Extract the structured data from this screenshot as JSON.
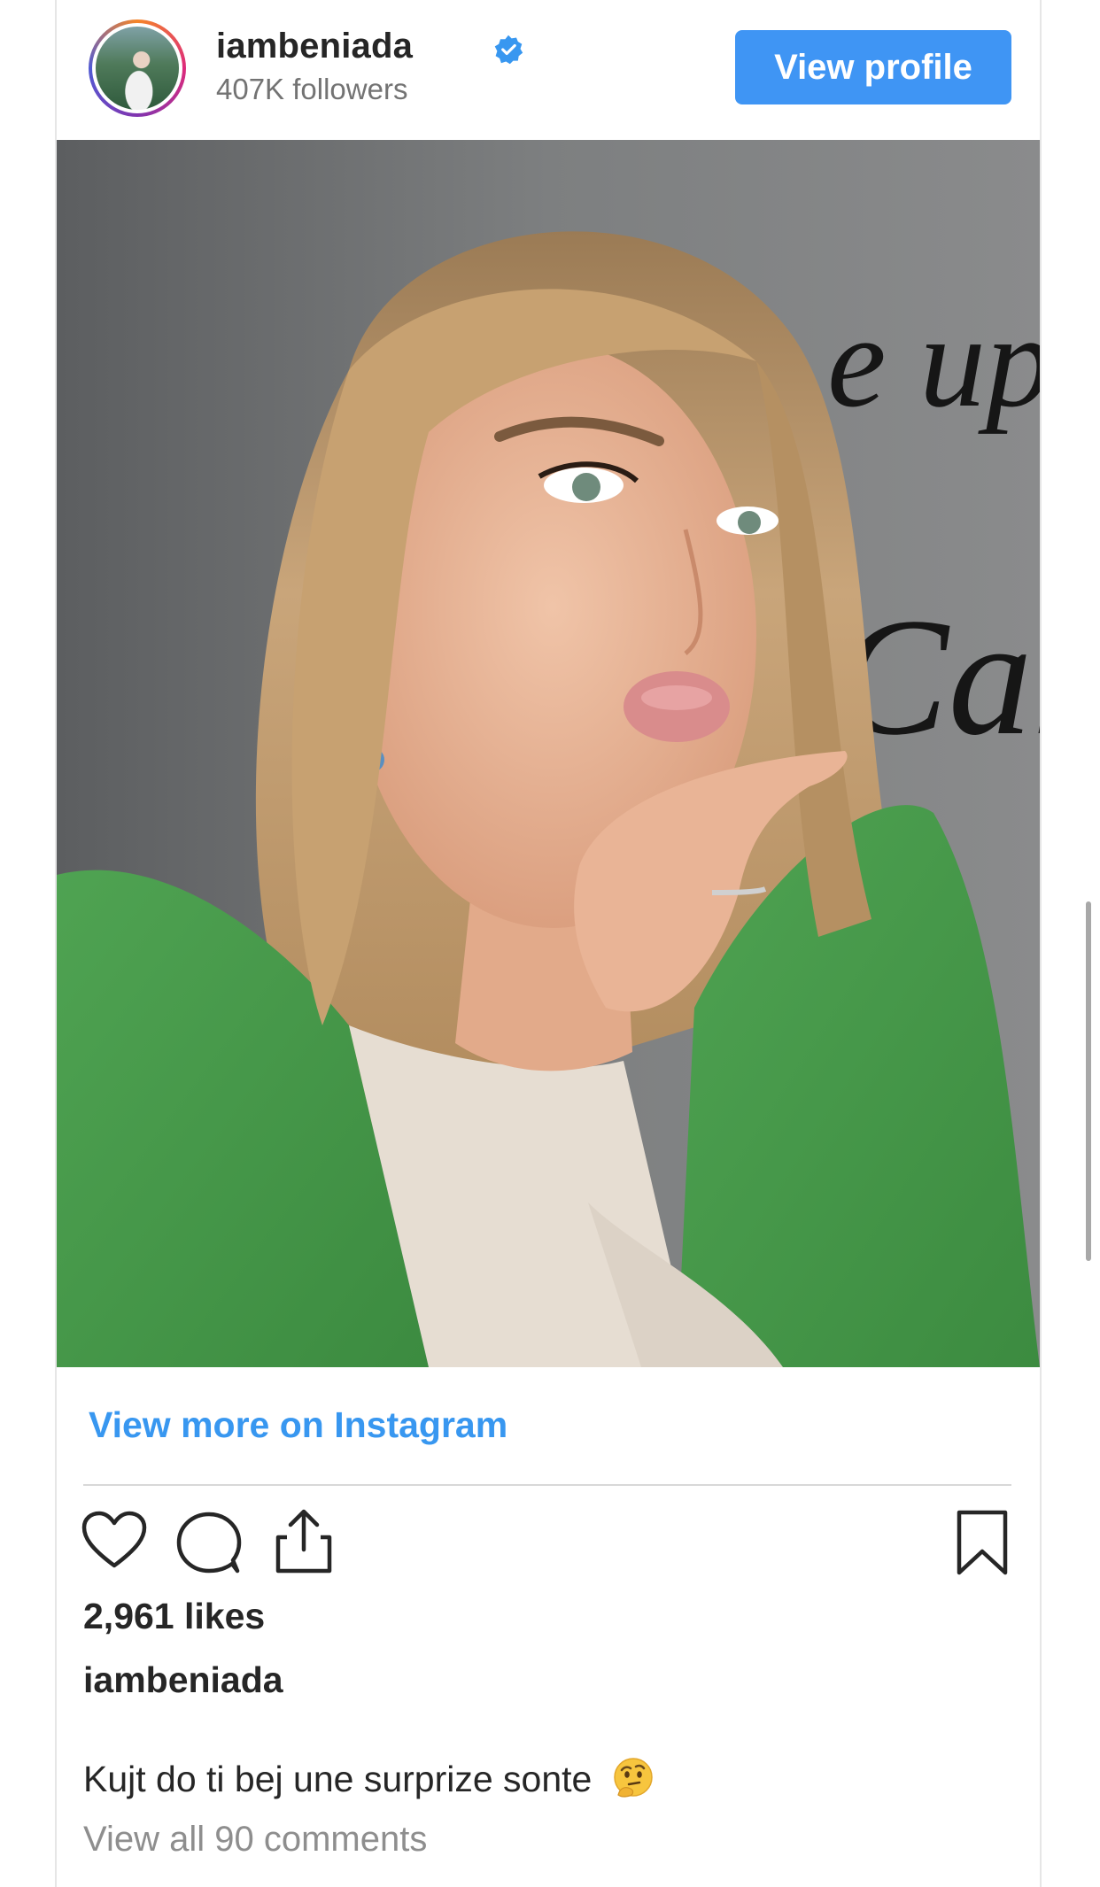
{
  "header": {
    "username": "iambeniada",
    "followers": "407K followers",
    "view_profile_label": "View profile"
  },
  "post": {
    "view_more_label": "View more on Instagram",
    "likes": "2,961 likes",
    "caption_user": "iambeniada",
    "caption_text": "Kujt do ti bej une surprize sonte",
    "caption_emoji": "thinking-face-emoji",
    "view_comments_label": "View all 90 comments"
  },
  "photo_wall_text": [
    "e up",
    "Cang"
  ],
  "icons": {
    "verified": "verified-badge-icon",
    "like": "heart-icon",
    "comment": "comment-bubble-icon",
    "share": "share-icon",
    "save": "bookmark-icon"
  },
  "colors": {
    "accent": "#3f95f4",
    "link": "#3897f0",
    "text": "#262626",
    "muted": "#8e8e8e"
  }
}
